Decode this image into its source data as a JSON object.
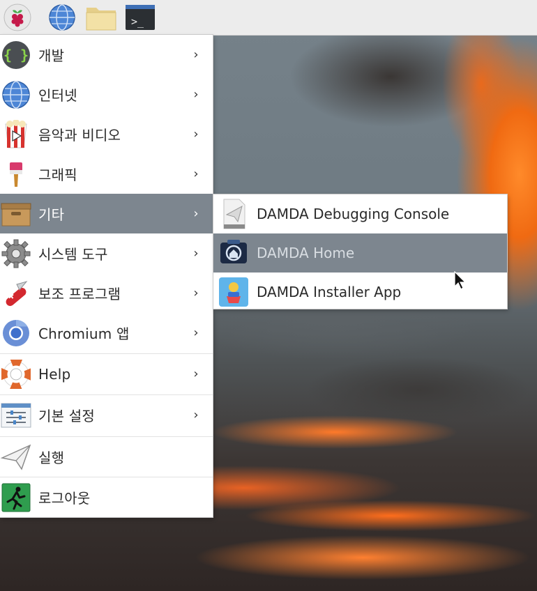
{
  "taskbar": {
    "buttons": [
      {
        "name": "raspberry-menu-button",
        "icon": "raspberry-pi-icon"
      },
      {
        "name": "web-browser-button",
        "icon": "globe-icon"
      },
      {
        "name": "file-manager-button",
        "icon": "folder-icon"
      },
      {
        "name": "terminal-button",
        "icon": "terminal-icon",
        "text": ">_"
      }
    ]
  },
  "main_menu": {
    "items": [
      {
        "label": "개발",
        "icon": "code-braces-icon",
        "has_submenu": true
      },
      {
        "label": "인터넷",
        "icon": "globe-icon",
        "has_submenu": true
      },
      {
        "label": "음악과 비디오",
        "icon": "popcorn-play-icon",
        "has_submenu": true
      },
      {
        "label": "그래픽",
        "icon": "paintbrush-icon",
        "has_submenu": true
      },
      {
        "label": "기타",
        "icon": "archive-box-icon",
        "has_submenu": true,
        "active": true
      },
      {
        "label": "시스템 도구",
        "icon": "gear-icon",
        "has_submenu": true
      },
      {
        "label": "보조 프로그램",
        "icon": "swiss-knife-icon",
        "has_submenu": true
      },
      {
        "label": "Chromium 앱",
        "icon": "chromium-icon",
        "has_submenu": true
      },
      {
        "label": "Help",
        "icon": "lifebuoy-icon",
        "has_submenu": true
      },
      {
        "label": "기본 설정",
        "icon": "preferences-sliders-icon",
        "has_submenu": true
      },
      {
        "label": "실행",
        "icon": "paper-plane-icon",
        "has_submenu": false
      },
      {
        "label": "로그아웃",
        "icon": "exit-running-man-icon",
        "has_submenu": false
      }
    ],
    "chevron": "›"
  },
  "sub_menu": {
    "items": [
      {
        "label": "DAMDA Debugging Console",
        "icon": "paper-plane-app-icon"
      },
      {
        "label": "DAMDA Home",
        "icon": "damda-home-icon",
        "highlighted": true
      },
      {
        "label": "DAMDA Installer App",
        "icon": "damda-installer-icon"
      }
    ]
  },
  "colors": {
    "menu_bg": "#ffffff",
    "highlight": "#7d868f",
    "taskbar_bg": "#ececec",
    "text": "#2a2a2a"
  }
}
